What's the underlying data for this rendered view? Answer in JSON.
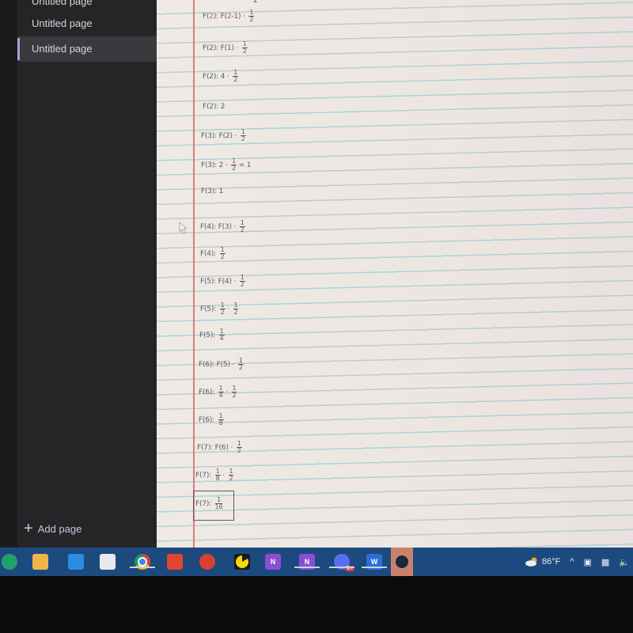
{
  "sidebar": {
    "pages": [
      {
        "label": "Untitled page",
        "selected": false,
        "partial": true
      },
      {
        "label": "Untitled page",
        "selected": false
      },
      {
        "label": "Untitled page",
        "selected": true
      }
    ],
    "add_page_label": "Add page",
    "accent_color": "#b59ad8"
  },
  "notes": {
    "lines": [
      {
        "lhs": "F(2)",
        "eq": "F(2-1)",
        "frac": [
          "1",
          "2"
        ],
        "highlight": "2"
      },
      {
        "lhs": "F(2)",
        "eq": "F(1)",
        "frac": [
          "1",
          "2"
        ]
      },
      {
        "lhs": "F(2)",
        "eq": "4",
        "frac": [
          "1",
          "2"
        ]
      },
      {
        "lhs": "F(2)",
        "eq": "2"
      },
      {
        "lhs": "F(3)",
        "eq": "F(2)",
        "frac": [
          "1",
          "2"
        ]
      },
      {
        "lhs": "F(3)",
        "eq": "2",
        "frac": [
          "1",
          "2"
        ],
        "tail": "= 1"
      },
      {
        "lhs": "F(3)",
        "eq": "1"
      },
      {
        "lhs": "F(4)",
        "eq": "F(3)",
        "frac": [
          "1",
          "2"
        ]
      },
      {
        "lhs": "F(4)",
        "frac_only": [
          "1",
          "2"
        ]
      },
      {
        "lhs": "F(5)",
        "eq": "F(4)",
        "frac": [
          "1",
          "2"
        ]
      },
      {
        "lhs": "F(5)",
        "frac_only": [
          "1",
          "2"
        ],
        "frac": [
          "1",
          "2"
        ]
      },
      {
        "lhs": "F(5)",
        "frac_only": [
          "1",
          "4"
        ]
      },
      {
        "lhs": "F(6)",
        "eq": "F(5)",
        "frac": [
          "1",
          "2"
        ]
      },
      {
        "lhs": "F(6)",
        "frac_only": [
          "1",
          "4"
        ],
        "frac": [
          "1",
          "2"
        ]
      },
      {
        "lhs": "F(6)",
        "frac_only": [
          "1",
          "8"
        ]
      },
      {
        "lhs": "F(7)",
        "eq": "F(6)",
        "frac": [
          "1",
          "2"
        ]
      },
      {
        "lhs": "F(7)",
        "frac_only": [
          "1",
          "8"
        ],
        "frac": [
          "1",
          "2"
        ]
      },
      {
        "lhs": "F(7)",
        "frac_only": [
          "1",
          "16"
        ],
        "boxed": true
      }
    ],
    "top_partial": "2",
    "ink_color": "#5a5b60",
    "highlight_color": "#e0457b",
    "margin_color": "#e07a80"
  },
  "taskbar": {
    "apps": [
      {
        "name": "edge",
        "label": ""
      },
      {
        "name": "file-explorer",
        "label": ""
      },
      {
        "name": "mail",
        "label": ""
      },
      {
        "name": "microsoft-store",
        "label": ""
      },
      {
        "name": "chrome",
        "label": "",
        "active": true
      },
      {
        "name": "office",
        "label": ""
      },
      {
        "name": "app-red",
        "label": ""
      },
      {
        "name": "pacman",
        "label": ""
      },
      {
        "name": "onenote",
        "label": "N"
      },
      {
        "name": "onenote-active",
        "label": "N",
        "active": true
      },
      {
        "name": "discord",
        "label": "",
        "badge": "9+",
        "active": true
      },
      {
        "name": "word",
        "label": "W",
        "active": true
      },
      {
        "name": "steam",
        "label": ""
      }
    ],
    "weather": "86°F"
  }
}
